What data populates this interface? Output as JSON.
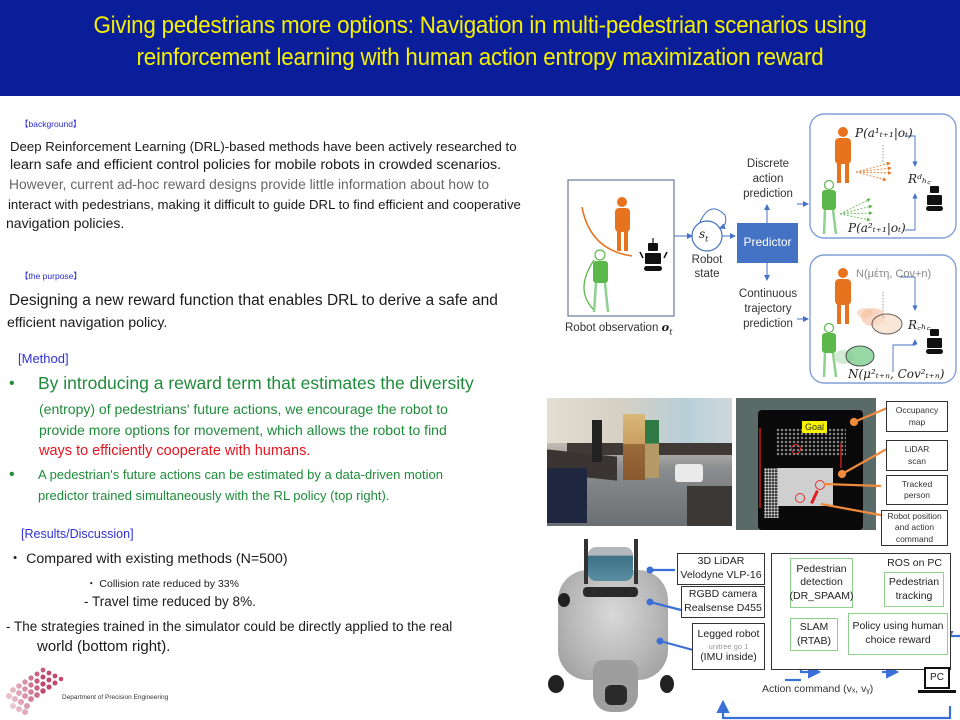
{
  "header": {
    "title_line1": "Giving pedestrians more options: Navigation in multi-pedestrian scenarios using",
    "title_line2": "reinforcement learning with human action entropy maximization reward",
    "background_color": "#0a1e9a",
    "text_color": "#f5f000"
  },
  "background": {
    "tag": "【background】",
    "lines": [
      "Deep Reinforcement Learning (DRL)-based methods have been actively researched to",
      "learn safe and efficient control policies for mobile robots in crowded scenarios.",
      "However, current ad-hoc reward designs provide little information about how to",
      "interact with pedestrians, making it difficult to guide DRL to find efficient and cooperative",
      "navigation policies."
    ]
  },
  "purpose": {
    "tag": "【the purpose】",
    "lines": [
      "Designing a new reward function that enables DRL to derive a safe and",
      "efficient navigation policy."
    ]
  },
  "method": {
    "heading": "[Method]",
    "bullet_glyph": "•",
    "bullet1": {
      "line1": "By introducing a reward term that estimates the diversity",
      "line2": "(entropy) of pedestrians' future actions, we encourage the robot to",
      "line3": "provide more options for movement, which allows the robot to find",
      "line4_highlight": "ways to efficiently cooperate with humans."
    },
    "bullet2": {
      "line1": "A pedestrian's future actions can be estimated by a data-driven motion",
      "line2": "predictor trained simultaneously with the RL policy (top right)."
    }
  },
  "results": {
    "heading": "[Results/Discussion]",
    "item1": "・ Compared with existing methods (N=500)",
    "sub1": "・ Collision rate reduced by 33%",
    "sub2": "- Travel time reduced by 8%.",
    "item2_line1": "- The strategies trained in the simulator could be directly applied to the real",
    "item2_line2": "world (bottom right)."
  },
  "footer": {
    "department": "Department of Precision Engineering"
  },
  "diagram_top": {
    "observation_label": "Robot observation",
    "observation_symbol": "o",
    "observation_sub": "t",
    "state_symbol": "s",
    "state_sub": "t",
    "state_label_line1": "Robot",
    "state_label_line2": "state",
    "predictor_label": "Predictor",
    "discrete_line1": "Discrete",
    "discrete_line2": "action",
    "discrete_line3": "prediction",
    "continuous_line1": "Continuous",
    "continuous_line2": "trajectory",
    "continuous_line3": "prediction",
    "p1": "P(a¹ₜ₊₁|oₜ)",
    "p2": "P(a²ₜ₊₁|oₜ)",
    "r_discrete": "Rᵈₕ꜀",
    "n1": "N(μέτη, Cov+n)",
    "n2": "N(μ²ₜ₊ₙ, Cov²ₜ₊ₙ)",
    "r_continuous": "R꜀ₕ꜀",
    "colors": {
      "predictor": "#4472c4",
      "orange_person": "#e8731e",
      "green_person": "#5cb84a",
      "arrow": "#4472c4"
    }
  },
  "map_labels": {
    "goal": "Goal",
    "occupancy": "Occupancy map",
    "lidar": "LiDAR scan",
    "tracked": "Tracked person",
    "robot_pos": "Robot position and action command"
  },
  "system_diagram": {
    "lidar_line1": "3D LiDAR",
    "lidar_line2": "Velodyne VLP-16",
    "camera_line1": "RGBD camera",
    "camera_line2": "Realsense D455",
    "legged_line1": "Legged robot",
    "legged_line2": "unitree go 1",
    "legged_line3": "(IMU inside)",
    "ros_label": "ROS on PC",
    "detection_line1": "Pedestrian",
    "detection_line2": "detection",
    "detection_line3": "(DR_SPAAM)",
    "tracking_line1": "Pedestrian",
    "tracking_line2": "tracking",
    "slam_line1": "SLAM",
    "slam_line2": "(RTAB)",
    "policy_line1": "Policy using human",
    "policy_line2": "choice reward",
    "pc_label": "PC",
    "action_command": "Action command (vₓ, vᵧ)"
  }
}
